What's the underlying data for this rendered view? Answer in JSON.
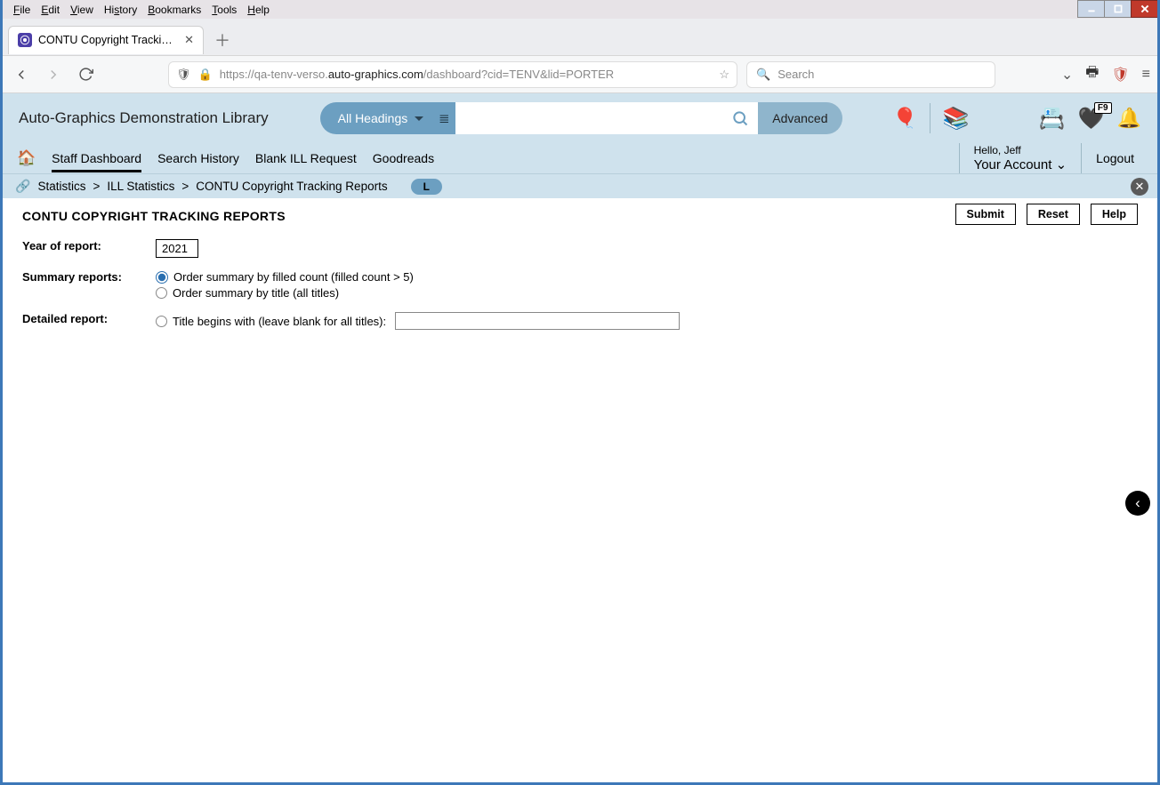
{
  "os_menu": {
    "file": "File",
    "edit": "Edit",
    "view": "View",
    "history": "History",
    "bookmarks": "Bookmarks",
    "tools": "Tools",
    "help": "Help"
  },
  "tab": {
    "title": "CONTU Copyright Tracking Rep"
  },
  "url": {
    "pre": "https://qa-tenv-verso.",
    "domain": "auto-graphics.com",
    "post": "/dashboard?cid=TENV&lid=PORTER"
  },
  "search_placeholder": "Search",
  "library_title": "Auto-Graphics Demonstration Library",
  "category_dd": "All Headings",
  "advanced": "Advanced",
  "nav": {
    "staff": "Staff Dashboard",
    "history": "Search History",
    "blank": "Blank ILL Request",
    "goodreads": "Goodreads"
  },
  "hello": "Hello, Jeff",
  "account": "Your Account",
  "logout": "Logout",
  "heart_badge": "F9",
  "crumbs": {
    "statistics": "Statistics",
    "ill": "ILL Statistics",
    "contu": "CONTU Copyright Tracking Reports",
    "chip": "L"
  },
  "page_title": "CONTU COPYRIGHT TRACKING REPORTS",
  "buttons": {
    "submit": "Submit",
    "reset": "Reset",
    "help": "Help"
  },
  "form": {
    "year_label": "Year of report:",
    "year_value": "2021",
    "summary_label": "Summary reports:",
    "summary_opt1": "Order summary by filled count (filled count > 5)",
    "summary_opt2": "Order summary by title (all titles)",
    "detailed_label": "Detailed report:",
    "detailed_opt": "Title begins with (leave blank for all titles):"
  }
}
